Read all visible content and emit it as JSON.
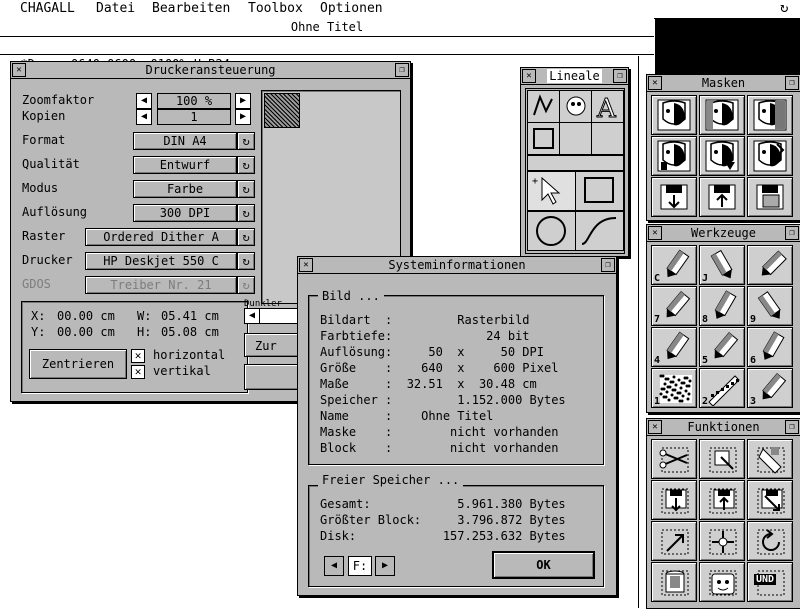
{
  "menubar": {
    "items": [
      "CHAGALL",
      "Datei",
      "Bearbeiten",
      "Toolbox",
      "Optionen"
    ]
  },
  "document": {
    "title": "Ohne Titel",
    "status": "*Draw  0640x0600  0100% U.R24"
  },
  "printer": {
    "title": "Druckeransteuerung",
    "zoom_label": "Zoomfaktor",
    "zoom_value": "100 %",
    "copies_label": "Kopien",
    "copies_value": "1",
    "rows": [
      {
        "label": "Format",
        "value": "DIN A4"
      },
      {
        "label": "Qualität",
        "value": "Entwurf"
      },
      {
        "label": "Modus",
        "value": "Farbe"
      },
      {
        "label": "Auflösung",
        "value": "300 DPI"
      },
      {
        "label": "Raster",
        "value": "Ordered Dither A"
      },
      {
        "label": "Drucker",
        "value": "HP Deskjet 550 C"
      },
      {
        "label": "GDOS",
        "value": "Treiber Nr. 21"
      }
    ],
    "x_label": "X:",
    "x_value": "00.00 cm",
    "y_label": "Y:",
    "y_value": "00.00 cm",
    "w_label": "W:",
    "w_value": "05.41 cm",
    "h_label": "H:",
    "h_value": "05.08 cm",
    "center_button": "Zentrieren",
    "horizontal_label": "horizontal",
    "vertical_label": "vertikal",
    "darker_label": "Dunkler",
    "partial_button": "Zur"
  },
  "lineale": {
    "title": "Lineale"
  },
  "masken": {
    "title": "Masken"
  },
  "werkzeuge": {
    "title": "Werkzeuge",
    "numbers": [
      "C",
      "J",
      "",
      "7",
      "8",
      "9",
      "4",
      "5",
      "6",
      "1",
      "2",
      "3"
    ]
  },
  "funktionen": {
    "title": "Funktionen",
    "und_label": "UND"
  },
  "sysinfo": {
    "title": "Systeminformationen",
    "bild_title": "Bild ...",
    "rows": [
      "Bildart  :         Rasterbild",
      "Farbtiefe:             24 bit",
      "Auflösung:     50  x     50 DPI",
      "Größe    :    640  x    600 Pixel",
      "Maße     :  32.51  x  30.48 cm",
      "Speicher :         1.152.000 Bytes",
      "Name     :    Ohne Titel",
      "Maske    :        nicht vorhanden",
      "Block    :        nicht vorhanden"
    ],
    "memory_title": "Freier Speicher ...",
    "memory_rows": [
      "Gesamt:            5.961.380 Bytes",
      "Größter Block:     3.796.872 Bytes",
      "Disk:            157.253.632 Bytes"
    ],
    "drive_value": "F:",
    "ok_button": "OK"
  }
}
